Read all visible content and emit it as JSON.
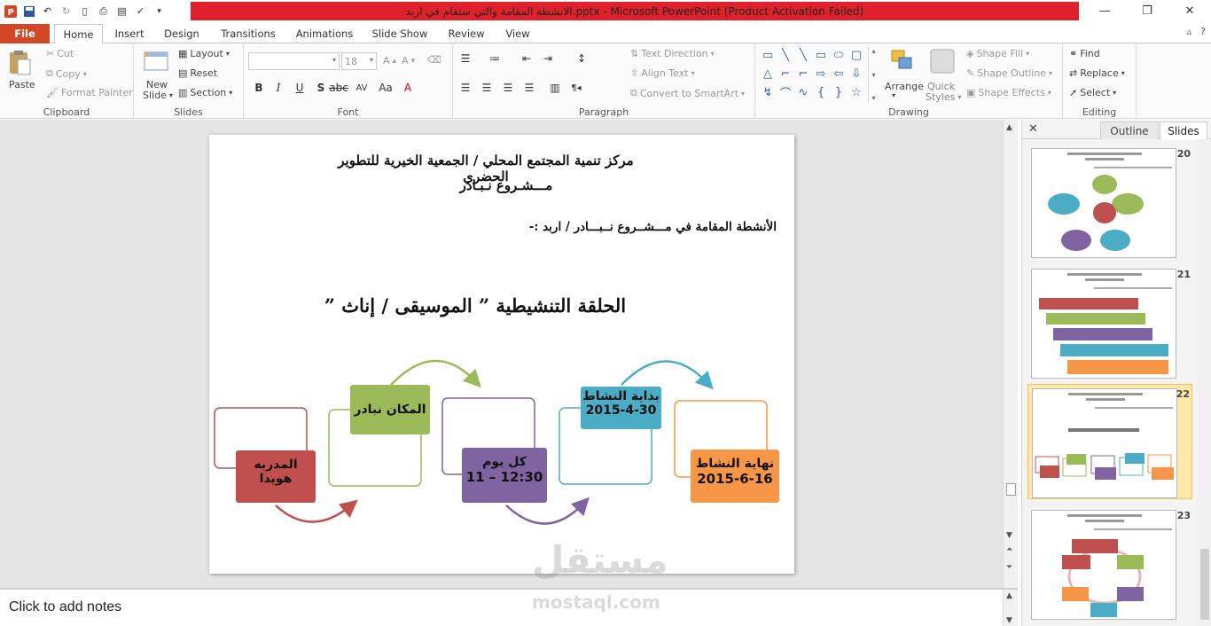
{
  "titlebar": {
    "title": "الانشطة  المقامة والتي ستقام في  اربد.pptx  -  Microsoft PowerPoint (Product Activation Failed)"
  },
  "tabs": [
    "File",
    "Home",
    "Insert",
    "Design",
    "Transitions",
    "Animations",
    "Slide Show",
    "Review",
    "View"
  ],
  "ribbon": {
    "clipboard": {
      "paste": "Paste",
      "cut": "Cut",
      "copy": "Copy",
      "format_painter": "Format Painter",
      "label": "Clipboard"
    },
    "slides": {
      "new_slide": "New",
      "new_slide2": "Slide",
      "layout": "Layout",
      "reset": "Reset",
      "section": "Section",
      "label": "Slides"
    },
    "font": {
      "font_name": "",
      "font_size": "18",
      "label": "Font"
    },
    "paragraph": {
      "text_direction": "Text Direction",
      "align_text": "Align Text",
      "smartart": "Convert to SmartArt",
      "label": "Paragraph"
    },
    "drawing": {
      "arrange": "Arrange",
      "quick_styles": "Quick",
      "quick_styles2": "Styles",
      "shape_fill": "Shape Fill",
      "shape_outline": "Shape Outline",
      "shape_effects": "Shape Effects",
      "label": "Drawing"
    },
    "editing": {
      "find": "Find",
      "replace": "Replace",
      "select": "Select",
      "label": "Editing"
    }
  },
  "slide": {
    "header_line1": "مركز تنمية المجتمع المحلي / الجمعية الخيرية للتطوير الحضري",
    "header_line2": "مـــشـروع نـبـادر",
    "subtitle": "الأنشطة المقامة في مـــشــروع نــبـــادر / اربد :-",
    "main_title": "الحلقة التنشيطية ” الموسيقى / إناث ”",
    "boxes": [
      {
        "line1": "المدربه",
        "line2": "هويدا",
        "color": "#c0504d"
      },
      {
        "line1": "المكان نبادر",
        "line2": "",
        "color": "#9bbb59"
      },
      {
        "line1": "كل يوم",
        "line2": "11 – 12:30",
        "color": "#8064a2"
      },
      {
        "line1": "بداية النشاط",
        "line2": "2015-4-30",
        "color": "#4bacc6"
      },
      {
        "line1": "نهاية النشاط",
        "line2": "2015-6-16",
        "color": "#f79646"
      }
    ]
  },
  "watermark": {
    "arabic": "مستقل",
    "latin": "mostaql.com"
  },
  "notes": {
    "placeholder": "Click to add notes"
  },
  "panel": {
    "tab_outline": "Outline",
    "tab_slides": "Slides",
    "thumbnails": [
      {
        "number": "20",
        "selected": false
      },
      {
        "number": "21",
        "selected": false
      },
      {
        "number": "22",
        "selected": true
      },
      {
        "number": "23",
        "selected": false
      }
    ]
  }
}
